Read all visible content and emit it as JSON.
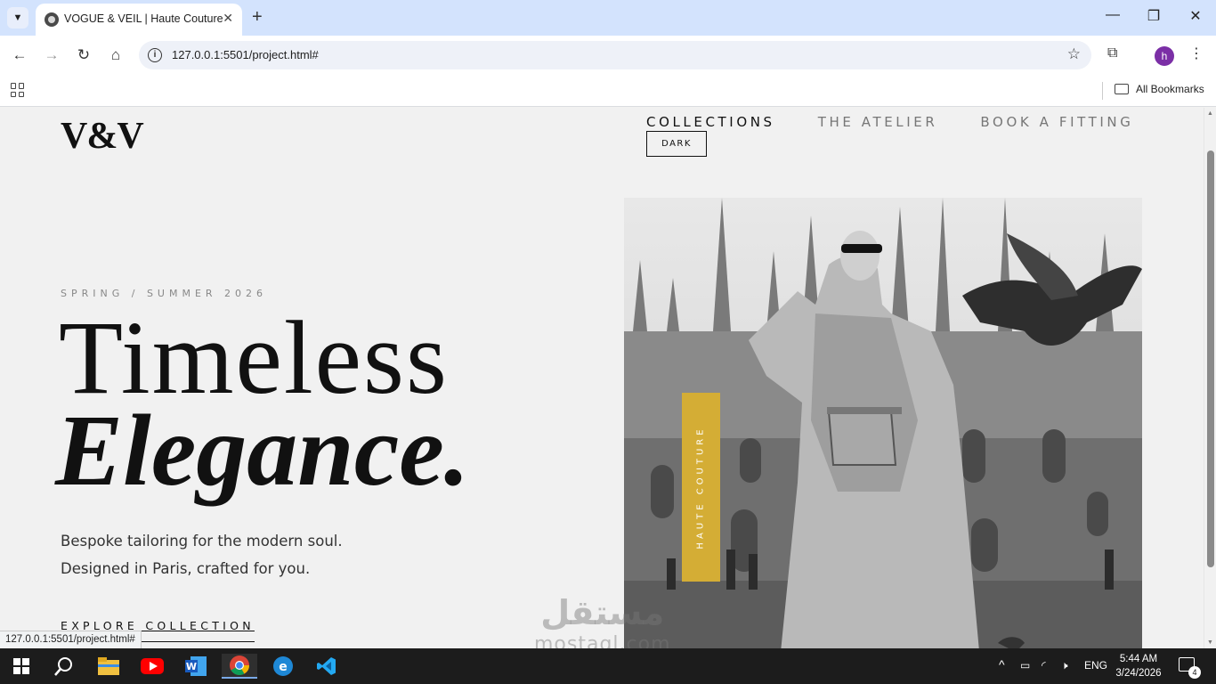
{
  "browser": {
    "tab_title": "VOGUE & VEIL | Haute Couture",
    "url": "127.0.0.1:5501/project.html#",
    "bookmarks_label": "All Bookmarks",
    "profile_initial": "h",
    "status_url": "127.0.0.1:5501/project.html#"
  },
  "site": {
    "logo": "V&V",
    "nav": [
      "COLLECTIONS",
      "THE ATELIER",
      "BOOK A FITTING"
    ],
    "theme_toggle": "DARK",
    "season": "SPRING / SUMMER 2026",
    "headline_line1": "Timeless",
    "headline_line2": "Elegance.",
    "desc_line1": "Bespoke tailoring for the modern soul.",
    "desc_line2": "Designed in Paris, crafted for you.",
    "cta": "EXPLORE COLLECTION",
    "badge": "HAUTE COUTURE",
    "accent_color": "#d4ad35"
  },
  "taskbar": {
    "language": "ENG",
    "time": "5:44 AM",
    "date": "3/24/2026",
    "notification_count": "4",
    "apps": [
      "windows-start-icon",
      "search-icon",
      "file-explorer-icon",
      "youtube-icon",
      "word-icon",
      "chrome-icon",
      "edge-legacy-icon",
      "vscode-icon"
    ]
  },
  "watermark": {
    "arabic": "مستقل",
    "latin": "mostaql.com"
  }
}
